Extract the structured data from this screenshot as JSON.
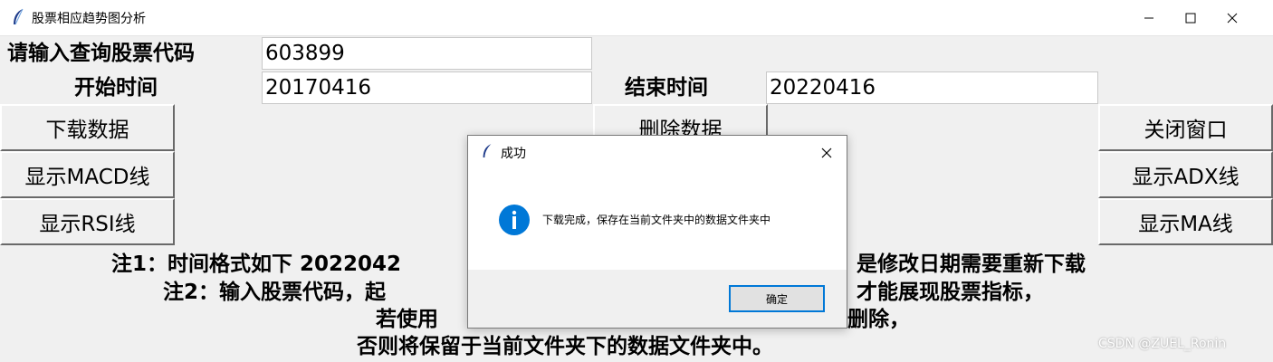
{
  "window": {
    "title": "股票相应趋势图分析"
  },
  "form": {
    "code_label": "请输入查询股票代码",
    "code_value": "603899",
    "start_label": "开始时间",
    "start_value": "20170416",
    "end_label": "结束时间",
    "end_value": "20220416"
  },
  "buttons": {
    "download": "下载数据",
    "delete": "删除数据",
    "close": "关闭窗口",
    "macd": "显示MACD线",
    "adx": "显示ADX线",
    "rsi": "显示RSI线",
    "ma": "显示MA线"
  },
  "notes": {
    "line1_left": "注1：时间格式如下 2022042",
    "line1_right": "是修改日期需要重新下载",
    "line2_left": "注2：输入股票代码，起",
    "line2_right": "才能展现股票指标，",
    "line3_left": "若使用",
    "line3_right": "删除，",
    "line4": "否则将保留于当前文件夹下的数据文件夹中。"
  },
  "dialog": {
    "title": "成功",
    "message": "下载完成，保存在当前文件夹中的数据文件夹中",
    "ok_label": "确定",
    "icon": "info-icon"
  },
  "watermark": "CSDN @ZUEL_Ronin",
  "colors": {
    "window_bg": "#f0f0f0",
    "info_blue": "#0078d7",
    "dialog_focus": "#0078d7"
  }
}
